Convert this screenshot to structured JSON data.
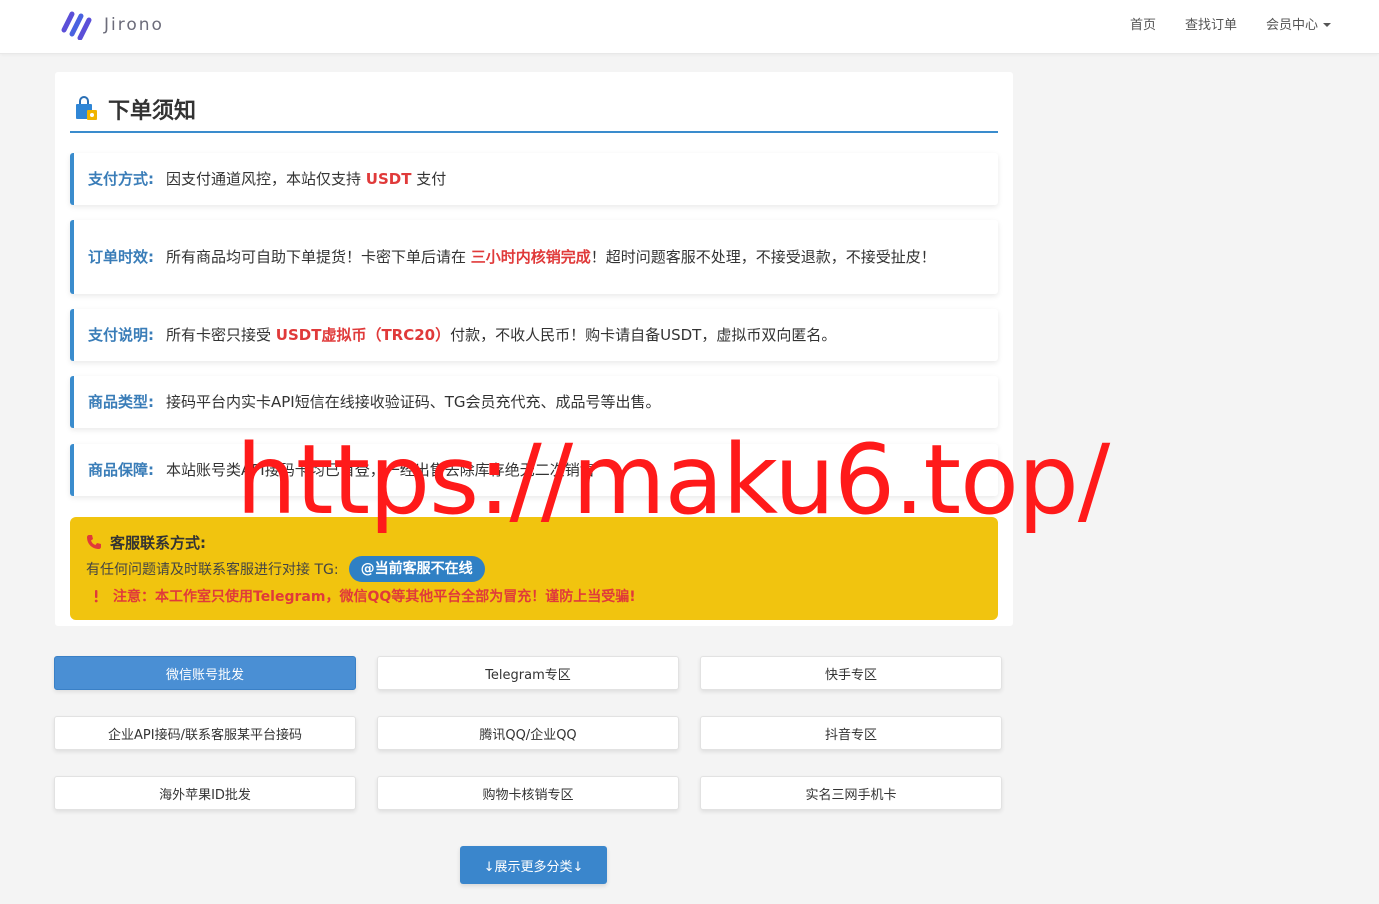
{
  "navbar": {
    "brand": "Jirono",
    "links": [
      "首页",
      "查找订单",
      "会员中心"
    ]
  },
  "notice": {
    "title": "下单须知",
    "rules": [
      {
        "label": "支付方式:",
        "pre": "因支付通道风控，本站仅支持 ",
        "highlight": "USDT",
        "post": " 支付"
      },
      {
        "label": "订单时效:",
        "pre": "所有商品均可自助下单提货！卡密下单后请在 ",
        "highlight": "三小时内核销完成",
        "post": "！超时问题客服不处理，不接受退款，不接受扯皮！"
      },
      {
        "label": "支付说明:",
        "pre": "所有卡密只接受 ",
        "highlight": "USDT虚拟币（TRC20）",
        "post": "付款，不收人民币！购卡请自备USDT，虚拟币双向匿名。"
      },
      {
        "label": "商品类型:",
        "pre": "接码平台内实卡API短信在线接收验证码、TG会员充代充、成品号等出售。",
        "highlight": "",
        "post": ""
      },
      {
        "label": "商品保障:",
        "pre": "本站账号类API接码卡均已首登，一经出售去除库存绝无二次销售",
        "highlight": "",
        "post": ""
      }
    ],
    "contact": {
      "title": "客服联系方式:",
      "desc": "有任何问题请及时联系客服进行对接 TG:",
      "tg_status": "@当前客服不在线",
      "warning": "注意：本工作室只使用Telegram，微信QQ等其他平台全部为冒充！谨防上当受骗!"
    }
  },
  "categories": [
    "微信账号批发",
    "Telegram专区",
    "快手专区",
    "企业API接码/联系客服某平台接码",
    "腾讯QQ/企业QQ",
    "抖音专区",
    "海外苹果ID批发",
    "购物卡核销专区",
    "实名三网手机卡"
  ],
  "active_category": "微信账号批发",
  "more_button": "↓展示更多分类↓",
  "watermark": "https://maku6.top/",
  "colors": {
    "accent": "#3a8ccd",
    "highlight": "#e03a3a",
    "notice_yellow": "#f1c40f",
    "tg_badge": "#2f80c4"
  }
}
